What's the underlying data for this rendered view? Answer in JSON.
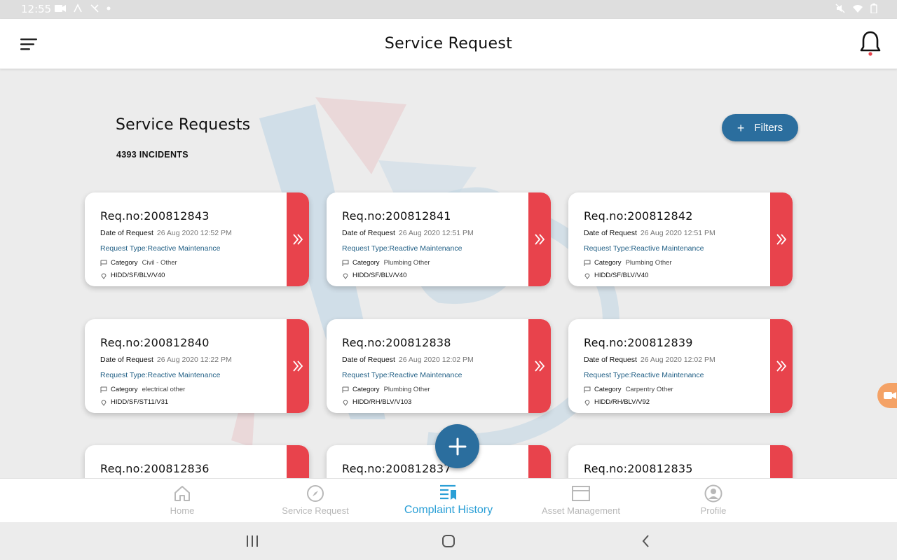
{
  "status_bar": {
    "time": "12:55"
  },
  "app_bar": {
    "title": "Service Request"
  },
  "list": {
    "title": "Service Requests",
    "count": "4393 INCIDENTS",
    "filters_label": "Filters"
  },
  "labels": {
    "date": "Date of Request",
    "category": "Category"
  },
  "cards": [
    {
      "req": "Req.no:200812843",
      "date": "26 Aug 2020 12:52 PM",
      "type": "Request Type:Reactive Maintenance",
      "category": "Civil - Other",
      "location": "HIDD/SF/BLV/V40"
    },
    {
      "req": "Req.no:200812841",
      "date": "26 Aug 2020 12:51 PM",
      "type": "Request Type:Reactive Maintenance",
      "category": "Plumbing Other",
      "location": "HIDD/SF/BLV/V40"
    },
    {
      "req": "Req.no:200812842",
      "date": "26 Aug 2020 12:51 PM",
      "type": "Request Type:Reactive Maintenance",
      "category": "Plumbing Other",
      "location": "HIDD/SF/BLV/V40"
    },
    {
      "req": "Req.no:200812840",
      "date": "26 Aug 2020 12:22 PM",
      "type": "Request Type:Reactive Maintenance",
      "category": "electrical other",
      "location": "HIDD/SF/ST11/V31"
    },
    {
      "req": "Req.no:200812838",
      "date": "26 Aug 2020 12:02 PM",
      "type": "Request Type:Reactive Maintenance",
      "category": "Plumbing Other",
      "location": "HIDD/RH/BLV/V103"
    },
    {
      "req": "Req.no:200812839",
      "date": "26 Aug 2020 12:02 PM",
      "type": "Request Type:Reactive Maintenance",
      "category": "Carpentry Other",
      "location": "HIDD/RH/BLV/V92"
    },
    {
      "req": "Req.no:200812836"
    },
    {
      "req": "Req.no:200812837"
    },
    {
      "req": "Req.no:200812835"
    }
  ],
  "bottom_nav": [
    {
      "label": "Home",
      "icon": "home-icon"
    },
    {
      "label": "Service Request",
      "icon": "compass-icon"
    },
    {
      "label": "Complaint History",
      "icon": "history-list-icon",
      "active": true
    },
    {
      "label": "Asset Management",
      "icon": "asset-box-icon"
    },
    {
      "label": "Profile",
      "icon": "profile-icon"
    }
  ],
  "colors": {
    "primary": "#2b6e9e",
    "accent_red": "#e8434c",
    "active_nav": "#2a9fd6",
    "request_type": "#1f5e84"
  }
}
